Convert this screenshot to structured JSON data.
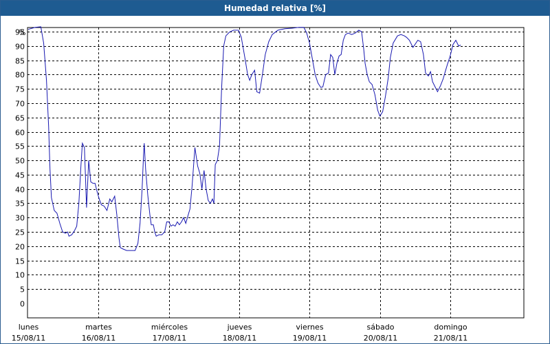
{
  "window": {
    "title": "Humedad relativa [%]"
  },
  "colors": {
    "title_bar": "#1e5b91",
    "line": "#1616b0",
    "grid": "#000000"
  },
  "chart_data": {
    "type": "line",
    "title": "Humedad relativa [%]",
    "ylabel": "%",
    "ylim": [
      0,
      100
    ],
    "ytick_labels": [
      "0",
      "5",
      "10",
      "15",
      "20",
      "25",
      "30",
      "35",
      "40",
      "45",
      "50",
      "55",
      "60",
      "65",
      "70",
      "75",
      "80",
      "85",
      "90",
      "95"
    ],
    "xlim": [
      0,
      7
    ],
    "xtick_labels": [
      {
        "day": "lunes",
        "date": "15/08/11"
      },
      {
        "day": "martes",
        "date": "16/08/11"
      },
      {
        "day": "miércoles",
        "date": "17/08/11"
      },
      {
        "day": "jueves",
        "date": "18/08/11"
      },
      {
        "day": "viernes",
        "date": "19/08/11"
      },
      {
        "day": "sábado",
        "date": "20/08/11"
      },
      {
        "day": "domingo",
        "date": "21/08/11"
      }
    ],
    "grid": true,
    "x_unit": "days from lunes 15/08/11 00:00",
    "series": [
      {
        "points": [
          [
            0.0,
            95.8
          ],
          [
            0.1,
            96.5
          ],
          [
            0.18,
            96.7
          ],
          [
            0.22,
            91
          ],
          [
            0.26,
            78
          ],
          [
            0.29,
            62
          ],
          [
            0.31,
            47
          ],
          [
            0.33,
            37
          ],
          [
            0.37,
            32.5
          ],
          [
            0.41,
            31.5
          ],
          [
            0.45,
            28
          ],
          [
            0.49,
            25
          ],
          [
            0.53,
            24.5
          ],
          [
            0.56,
            25
          ],
          [
            0.58,
            23.5
          ],
          [
            0.62,
            24
          ],
          [
            0.66,
            25.5
          ],
          [
            0.69,
            27
          ],
          [
            0.72,
            35
          ],
          [
            0.75,
            48
          ],
          [
            0.77,
            56
          ],
          [
            0.8,
            54.5
          ],
          [
            0.83,
            33.5
          ],
          [
            0.86,
            50
          ],
          [
            0.89,
            42.5
          ],
          [
            0.92,
            42
          ],
          [
            0.95,
            42
          ],
          [
            0.98,
            39
          ],
          [
            1.01,
            36.5
          ],
          [
            1.04,
            34.5
          ],
          [
            1.08,
            34
          ],
          [
            1.12,
            32.5
          ],
          [
            1.16,
            36.5
          ],
          [
            1.19,
            35.5
          ],
          [
            1.23,
            37.5
          ],
          [
            1.26,
            31
          ],
          [
            1.29,
            23
          ],
          [
            1.31,
            19.5
          ],
          [
            1.35,
            19
          ],
          [
            1.4,
            18.5
          ],
          [
            1.44,
            18.5
          ],
          [
            1.49,
            18.5
          ],
          [
            1.52,
            18.5
          ],
          [
            1.56,
            21
          ],
          [
            1.59,
            28
          ],
          [
            1.62,
            40
          ],
          [
            1.64,
            52
          ],
          [
            1.65,
            56
          ],
          [
            1.67,
            47
          ],
          [
            1.7,
            38
          ],
          [
            1.73,
            31
          ],
          [
            1.75,
            27.5
          ],
          [
            1.78,
            27.5
          ],
          [
            1.8,
            25
          ],
          [
            1.82,
            23.5
          ],
          [
            1.86,
            24
          ],
          [
            1.9,
            24
          ],
          [
            1.94,
            25
          ],
          [
            1.97,
            28.5
          ],
          [
            2.0,
            28.5
          ],
          [
            2.03,
            27
          ],
          [
            2.06,
            27.5
          ],
          [
            2.09,
            27
          ],
          [
            2.12,
            28.5
          ],
          [
            2.15,
            27.5
          ],
          [
            2.18,
            28.5
          ],
          [
            2.21,
            30
          ],
          [
            2.24,
            28
          ],
          [
            2.27,
            30.5
          ],
          [
            2.3,
            33
          ],
          [
            2.33,
            41
          ],
          [
            2.37,
            54.5
          ],
          [
            2.41,
            48
          ],
          [
            2.44,
            45.5
          ],
          [
            2.47,
            40
          ],
          [
            2.5,
            46.5
          ],
          [
            2.53,
            40
          ],
          [
            2.56,
            36
          ],
          [
            2.59,
            35
          ],
          [
            2.62,
            36.5
          ],
          [
            2.64,
            35
          ],
          [
            2.66,
            48.5
          ],
          [
            2.69,
            50
          ],
          [
            2.72,
            55
          ],
          [
            2.75,
            75
          ],
          [
            2.78,
            90
          ],
          [
            2.81,
            93.5
          ],
          [
            2.86,
            94.8
          ],
          [
            2.92,
            95.5
          ],
          [
            2.99,
            95.5
          ],
          [
            3.03,
            93
          ],
          [
            3.08,
            86
          ],
          [
            3.12,
            80
          ],
          [
            3.15,
            78
          ],
          [
            3.18,
            80
          ],
          [
            3.22,
            81.5
          ],
          [
            3.25,
            74
          ],
          [
            3.29,
            73.5
          ],
          [
            3.33,
            80
          ],
          [
            3.37,
            87
          ],
          [
            3.42,
            91.5
          ],
          [
            3.47,
            94
          ],
          [
            3.55,
            95.5
          ],
          [
            3.65,
            96
          ],
          [
            3.75,
            96.2
          ],
          [
            3.85,
            96.5
          ],
          [
            3.92,
            96.5
          ],
          [
            3.96,
            94.5
          ],
          [
            4.0,
            91
          ],
          [
            4.04,
            85.5
          ],
          [
            4.08,
            80
          ],
          [
            4.12,
            77
          ],
          [
            4.16,
            75.5
          ],
          [
            4.19,
            75.7
          ],
          [
            4.23,
            80
          ],
          [
            4.27,
            80.5
          ],
          [
            4.3,
            87
          ],
          [
            4.33,
            86
          ],
          [
            4.36,
            80
          ],
          [
            4.39,
            84
          ],
          [
            4.42,
            86.5
          ],
          [
            4.45,
            87
          ],
          [
            4.48,
            92
          ],
          [
            4.51,
            94
          ],
          [
            4.55,
            94.5
          ],
          [
            4.6,
            94
          ],
          [
            4.65,
            94.5
          ],
          [
            4.7,
            95.5
          ],
          [
            4.74,
            95
          ],
          [
            4.77,
            89
          ],
          [
            4.79,
            84
          ],
          [
            4.82,
            80
          ],
          [
            4.85,
            77.5
          ],
          [
            4.89,
            76.5
          ],
          [
            4.93,
            73
          ],
          [
            4.97,
            67.5
          ],
          [
            5.0,
            65.5
          ],
          [
            5.04,
            67
          ],
          [
            5.08,
            72.5
          ],
          [
            5.12,
            79
          ],
          [
            5.15,
            86
          ],
          [
            5.19,
            91
          ],
          [
            5.25,
            93.5
          ],
          [
            5.3,
            94
          ],
          [
            5.35,
            93.5
          ],
          [
            5.38,
            93
          ],
          [
            5.42,
            92
          ],
          [
            5.47,
            89.5
          ],
          [
            5.5,
            90.5
          ],
          [
            5.54,
            92
          ],
          [
            5.58,
            91.5
          ],
          [
            5.62,
            87
          ],
          [
            5.65,
            80.5
          ],
          [
            5.69,
            79.5
          ],
          [
            5.72,
            81
          ],
          [
            5.75,
            77.5
          ],
          [
            5.79,
            75.5
          ],
          [
            5.82,
            74
          ],
          [
            5.86,
            76
          ],
          [
            5.9,
            78.5
          ],
          [
            5.93,
            81
          ],
          [
            5.96,
            83.5
          ],
          [
            6.0,
            86.5
          ],
          [
            6.04,
            90.5
          ],
          [
            6.08,
            92
          ],
          [
            6.12,
            90
          ],
          [
            6.15,
            90.3
          ]
        ]
      }
    ]
  }
}
